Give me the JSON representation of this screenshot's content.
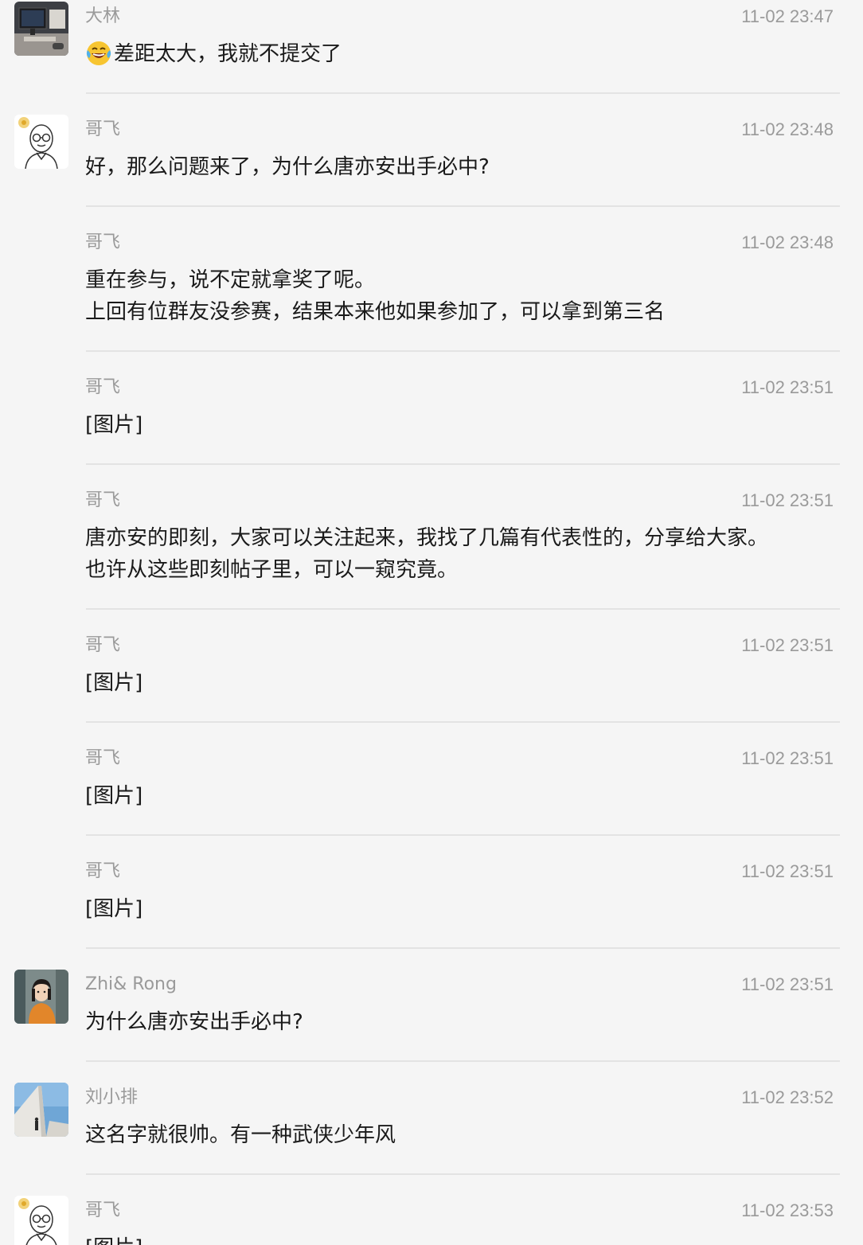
{
  "chat": {
    "messages": [
      {
        "sender": "大林",
        "time": "11-02 23:47",
        "avatar_icon": "desk-monitor-photo",
        "emoji_icon": "laughing-tears-emoji",
        "lines": [
          "差距太大，我就不提交了"
        ]
      },
      {
        "sender": "哥飞",
        "time": "11-02 23:48",
        "avatar_icon": "bald-glasses-cartoon",
        "lines": [
          "好，那么问题来了，为什么唐亦安出手必中?"
        ]
      },
      {
        "sender": "哥飞",
        "time": "11-02 23:48",
        "lines": [
          "重在参与，说不定就拿奖了呢。",
          "上回有位群友没参赛，结果本来他如果参加了，可以拿到第三名"
        ]
      },
      {
        "sender": "哥飞",
        "time": "11-02 23:51",
        "lines": [
          "[图片]"
        ]
      },
      {
        "sender": "哥飞",
        "time": "11-02 23:51",
        "lines": [
          "唐亦安的即刻，大家可以关注起来，我找了几篇有代表性的，分享给大家。",
          "也许从这些即刻帖子里，可以一窥究竟。"
        ]
      },
      {
        "sender": "哥飞",
        "time": "11-02 23:51",
        "lines": [
          "[图片]"
        ]
      },
      {
        "sender": "哥飞",
        "time": "11-02 23:51",
        "lines": [
          "[图片]"
        ]
      },
      {
        "sender": "哥飞",
        "time": "11-02 23:51",
        "lines": [
          "[图片]"
        ]
      },
      {
        "sender": "Zhi& Rong",
        "time": "11-02 23:51",
        "avatar_icon": "girl-orange-jacket",
        "lines": [
          "为什么唐亦安出手必中?"
        ]
      },
      {
        "sender": "刘小排",
        "time": "11-02 23:52",
        "avatar_icon": "building-stairs-photo",
        "lines": [
          "这名字就很帅。有一种武侠少年风"
        ]
      },
      {
        "sender": "哥飞",
        "time": "11-02 23:53",
        "avatar_icon": "bald-glasses-cartoon",
        "lines": [
          "[图片]"
        ]
      }
    ]
  }
}
